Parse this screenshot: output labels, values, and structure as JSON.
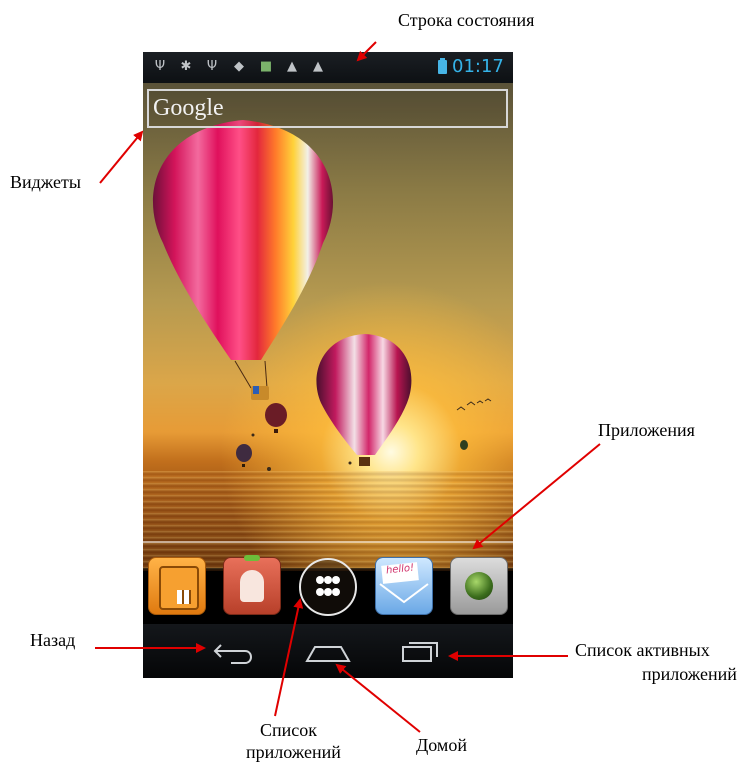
{
  "annotations": {
    "status_bar": "Строка состояния",
    "widgets": "Виджеты",
    "applications": "Приложения",
    "back": "Назад",
    "active_apps": "Список активных приложений",
    "active_apps_line1": "Список активных",
    "active_apps_line2": "приложений",
    "app_list_line1": "Список",
    "app_list_line2": "приложений",
    "home": "Домой"
  },
  "status_bar": {
    "time": "01:17",
    "icons": [
      "usb-icon",
      "android-debug-icon",
      "usb-icon",
      "wifi-icon",
      "gallery-icon",
      "warning-icon",
      "warning-icon",
      "battery-charging-icon"
    ]
  },
  "widget": {
    "search_label": "Google"
  },
  "dock": {
    "apps": [
      "phone-app-icon",
      "contacts-app-icon",
      "app-drawer-icon",
      "messaging-app-icon",
      "browser-app-icon"
    ],
    "message_icon_text": "hello!"
  },
  "navbar": {
    "buttons": [
      "back-icon",
      "home-icon",
      "recent-apps-icon"
    ]
  },
  "colors": {
    "status_accent": "#35b3e8",
    "arrow": "#e00000"
  }
}
